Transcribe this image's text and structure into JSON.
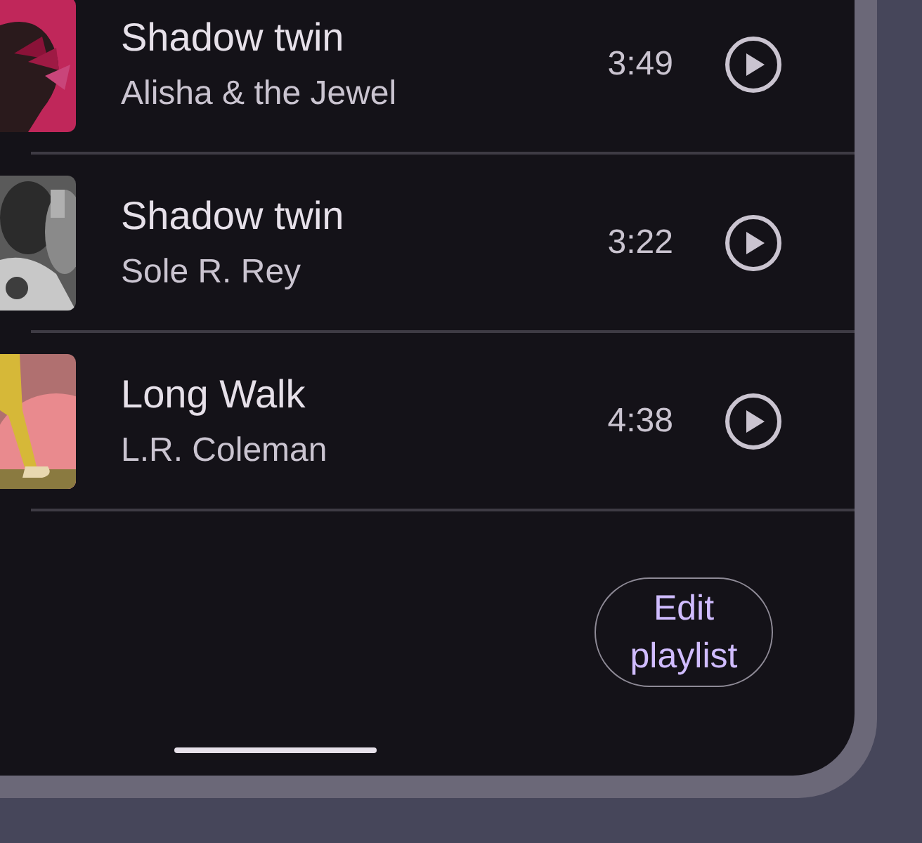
{
  "tracks": [
    {
      "title": "Shadow twin",
      "artist": "Alisha & the Jewel",
      "duration": "3:49"
    },
    {
      "title": "Shadow twin",
      "artist": "Sole R. Rey",
      "duration": "3:22"
    },
    {
      "title": "Long Walk",
      "artist": "L.R. Coleman",
      "duration": "4:38"
    }
  ],
  "edit_button": {
    "label": "Edit playlist"
  }
}
